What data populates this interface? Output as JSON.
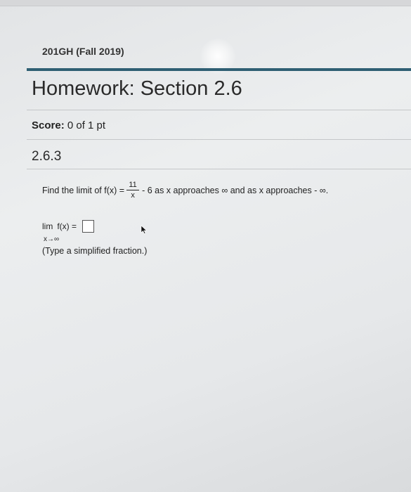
{
  "course": {
    "title": "201GH (Fall 2019)"
  },
  "assignment": {
    "title": "Homework: Section 2.6"
  },
  "score": {
    "label": "Score:",
    "value": "0 of 1 pt"
  },
  "question": {
    "number": "2.6.3",
    "prompt_before": "Find the limit of f(x) =",
    "fraction_numerator": "11",
    "fraction_denominator": "x",
    "prompt_after": "- 6 as x approaches ∞ and as x approaches - ∞.",
    "limit_label": "lim",
    "limit_function": "f(x) =",
    "limit_subscript": "x→∞",
    "answer_value": "",
    "hint": "(Type a simplified fraction.)"
  },
  "icons": {
    "cursor": "mouse-pointer-icon"
  }
}
